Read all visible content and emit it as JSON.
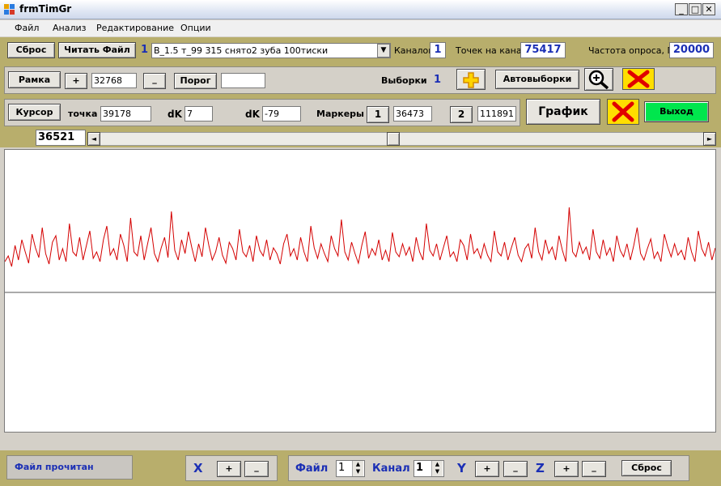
{
  "window": {
    "title": "frmTimGr"
  },
  "window_buttons": {
    "minimize": "_",
    "maximize": "□",
    "close": "✕"
  },
  "menu": [
    "Файл",
    "Анализ",
    "Редактирование",
    "Опции"
  ],
  "row1": {
    "reset_label": "Сброс",
    "read_file_label": "Читать Файл",
    "file_index": "1",
    "file_name": "B_1.5   т_99    315  снято2 зуба 100тиски",
    "channels_label": "Каналов",
    "channels_value": "1",
    "points_label": "Точек на канал",
    "points_value": "75417",
    "freq_label": "Частота опроса, Гц",
    "freq_value": "20000"
  },
  "row2": {
    "frame_label": "Рамка",
    "plus_label": "+",
    "frame_value": "32768",
    "minus_label": "_",
    "threshold_label": "Порог",
    "threshold_value": "",
    "samples_label": "Выборки",
    "samples_value": "1",
    "autosamples_label": "Автовыборки"
  },
  "row3": {
    "cursor_label": "Курсор",
    "point_label": "точка",
    "point_value": "39178",
    "dk1_label": "dK",
    "dk1_value": "7",
    "dk2_label": "dK",
    "dk2_value": "-79",
    "markers_label": "Маркеры",
    "marker1_button": "1",
    "marker1_value": "36473",
    "marker2_button": "2",
    "marker2_value": "111891",
    "graph_label": "График",
    "exit_label": "Выход"
  },
  "scroll": {
    "position_value": "36521",
    "left_arrow": "◄",
    "right_arrow": "►"
  },
  "status": {
    "text": "Файл прочитан"
  },
  "bottom": {
    "x_label": "X",
    "x_plus": "+",
    "x_minus": "_",
    "file_label": "Файл",
    "file_value": "1",
    "channel_label": "Канал",
    "channel_value": "1",
    "y_label": "Y",
    "y_plus": "+",
    "y_minus": "_",
    "z_label": "Z",
    "z_plus": "+",
    "z_minus": "_",
    "reset_label": "Сброс"
  },
  "colors": {
    "signal": "#d40000",
    "strip": "#b8ae6c",
    "exit_button": "#00e64d",
    "icon_yellow": "#ffde00"
  },
  "icons": [
    "app-icon",
    "plus-cross-icon",
    "zoom-in-icon",
    "red-x-icon",
    "red-x-icon-2"
  ],
  "chart_data": {
    "type": "line",
    "series": [
      {
        "values": [
          28,
          35,
          22,
          48,
          30,
          55,
          40,
          26,
          62,
          45,
          33,
          70,
          38,
          25,
          52,
          60,
          30,
          44,
          28,
          75,
          40,
          35,
          58,
          30,
          48,
          66,
          32,
          40,
          28,
          55,
          72,
          36,
          44,
          30,
          62,
          48,
          28,
          82,
          40,
          35,
          60,
          30,
          50,
          70,
          38,
          28,
          45,
          58,
          33,
          90,
          42,
          30,
          55,
          38,
          65,
          45,
          28,
          50,
          34,
          70,
          48,
          30,
          40,
          58,
          36,
          26,
          52,
          44,
          30,
          68,
          40,
          34,
          48,
          28,
          60,
          42,
          35,
          55,
          30,
          45,
          38,
          25,
          50,
          62,
          35,
          44,
          30,
          58,
          40,
          28,
          72,
          45,
          32,
          50,
          38,
          28,
          60,
          44,
          35,
          80,
          40,
          30,
          52,
          38,
          26,
          48,
          65,
          32,
          44,
          36,
          55,
          30,
          42,
          28,
          64,
          40,
          34,
          50,
          36,
          46,
          28,
          58,
          40,
          30,
          75,
          42,
          35,
          50,
          30,
          45,
          60,
          34,
          40,
          28,
          55,
          48,
          30,
          62,
          38,
          44,
          32,
          50,
          36,
          28,
          66,
          40,
          35,
          52,
          30,
          45,
          58,
          36,
          28,
          44,
          50,
          32,
          70,
          40,
          30,
          55,
          38,
          46,
          30,
          60,
          42,
          28,
          95,
          40,
          34,
          52,
          38,
          46,
          30,
          68,
          40,
          32,
          55,
          36,
          45,
          28,
          60,
          42,
          34,
          50,
          30,
          48,
          70,
          38,
          30,
          44,
          56,
          32,
          40,
          28,
          62,
          46,
          34,
          50,
          36,
          42,
          30,
          58,
          40,
          28,
          66,
          44,
          35,
          52,
          30,
          45
        ]
      }
    ]
  }
}
